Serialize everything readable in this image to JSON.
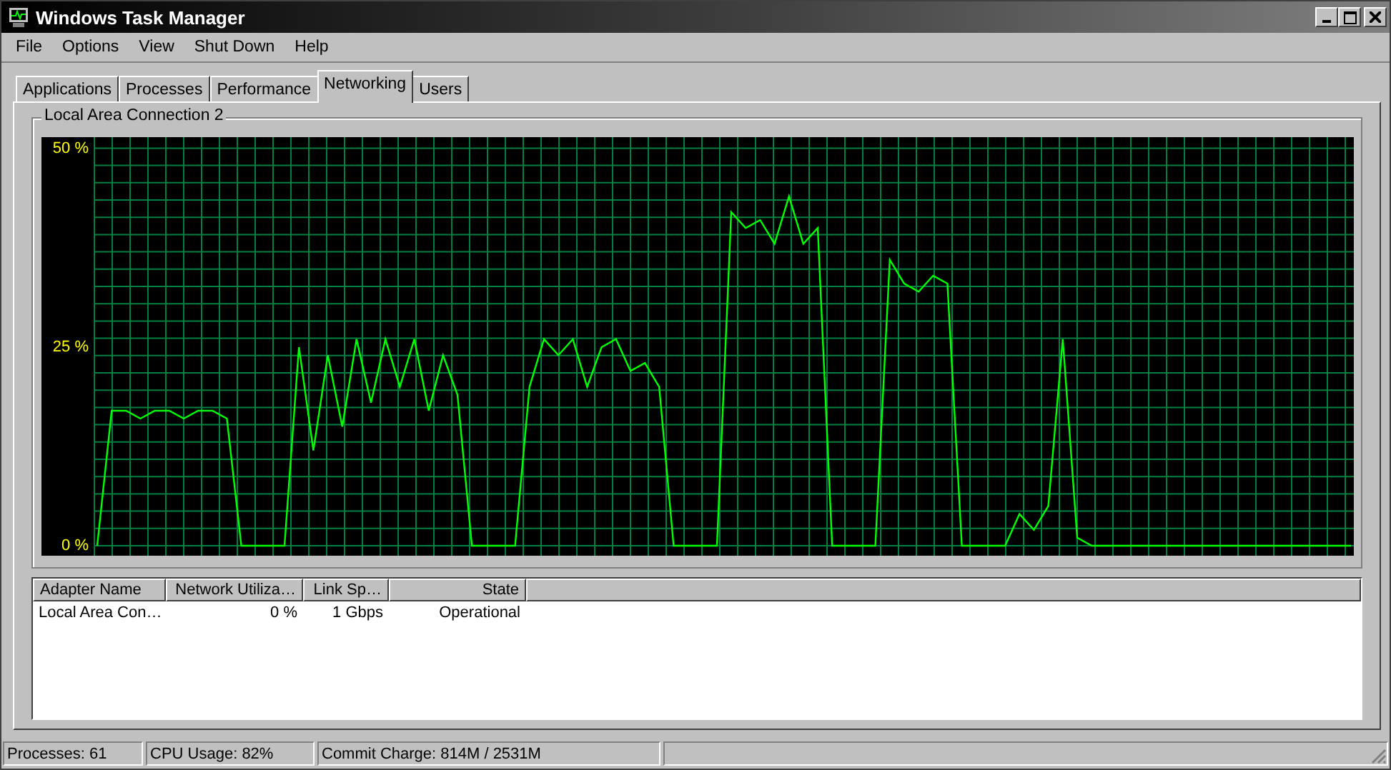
{
  "window": {
    "title": "Windows Task Manager"
  },
  "menu": [
    "File",
    "Options",
    "View",
    "Shut Down",
    "Help"
  ],
  "tabs": [
    {
      "label": "Applications",
      "selected": false
    },
    {
      "label": "Processes",
      "selected": false
    },
    {
      "label": "Performance",
      "selected": false
    },
    {
      "label": "Networking",
      "selected": true
    },
    {
      "label": "Users",
      "selected": false
    }
  ],
  "graph": {
    "title": "Local Area Connection 2",
    "chart_data": {
      "type": "line",
      "grid": true,
      "ylim": [
        0,
        50
      ],
      "yticks": [
        {
          "value": 0,
          "label": "0 %"
        },
        {
          "value": 25,
          "label": "25 %"
        },
        {
          "value": 50,
          "label": "50 %"
        }
      ],
      "series": [
        {
          "color": "#00ff00",
          "values": [
            0,
            17,
            17,
            16,
            17,
            17,
            16,
            17,
            17,
            16,
            0,
            0,
            0,
            0,
            25,
            12,
            24,
            15,
            26,
            18,
            26,
            20,
            26,
            17,
            24,
            19,
            0,
            0,
            0,
            0,
            20,
            26,
            24,
            26,
            20,
            25,
            26,
            22,
            23,
            20,
            0,
            0,
            0,
            0,
            42,
            40,
            41,
            38,
            44,
            38,
            40,
            0,
            0,
            0,
            0,
            36,
            33,
            32,
            34,
            33,
            0,
            0,
            0,
            0,
            4,
            2,
            5,
            26,
            1,
            0,
            0,
            0,
            0,
            0,
            0,
            0,
            0,
            0,
            0,
            0,
            0,
            0,
            0,
            0,
            0,
            0,
            0,
            0
          ]
        }
      ]
    }
  },
  "table": {
    "columns": [
      {
        "label": "Adapter Name"
      },
      {
        "label": "Network Utiliza…"
      },
      {
        "label": "Link Sp…"
      },
      {
        "label": "State"
      }
    ],
    "rows": [
      [
        "Local Area Con…",
        "0 %",
        "1 Gbps",
        "Operational"
      ]
    ]
  },
  "status_bar": [
    "Processes: 61",
    "CPU Usage: 82%",
    "Commit Charge: 814M / 2531M"
  ]
}
